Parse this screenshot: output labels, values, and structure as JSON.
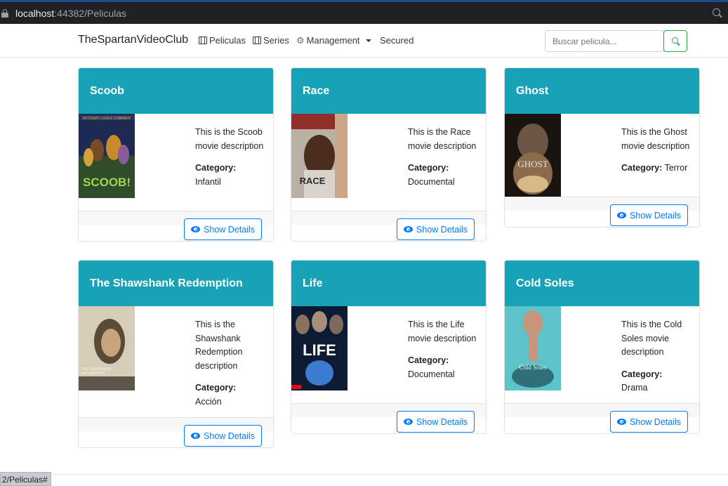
{
  "browser": {
    "url_host": "localhost",
    "url_rest": ":44382/Peliculas",
    "status_url": "2/Peliculas#"
  },
  "navbar": {
    "brand": "TheSpartanVideoClub",
    "items": [
      {
        "label": "Peliculas",
        "icon": "film-icon"
      },
      {
        "label": "Series",
        "icon": "film-icon"
      },
      {
        "label": "Management",
        "icon": "gear-icon"
      },
      {
        "label": "Secured"
      }
    ],
    "search_placeholder": "Buscar pelicula...",
    "search_button_color": "#28a745"
  },
  "movies": [
    {
      "title": "Scoob",
      "description": "This is the Scoob movie description",
      "category_label": "Category:",
      "category": "Infantil",
      "button": "Show Details"
    },
    {
      "title": "Race",
      "description": "This is the Race movie description",
      "category_label": "Category:",
      "category": "Documental",
      "button": "Show Details"
    },
    {
      "title": "Ghost",
      "description": "This is the Ghost movie description",
      "category_label": "Category:",
      "category": "Terror",
      "button": "Show Details"
    },
    {
      "title": "The Shawshank Redemption",
      "description": "This is the Shawshank Redemption description",
      "category_label": "Category:",
      "category": "Acción",
      "button": "Show Details"
    },
    {
      "title": "Life",
      "description": "This is the Life movie description",
      "category_label": "Category:",
      "category": "Documental",
      "button": "Show Details"
    },
    {
      "title": "Cold Soles",
      "description": "This is the Cold Soles movie description",
      "category_label": "Category:",
      "category": "Drama",
      "button": "Show Details"
    }
  ],
  "posters": {
    "scoob": "SCOOB!",
    "race": "RACE",
    "ghost": "GHOST",
    "shawshank": "THE SHAWSHANK REDEMPTION",
    "life": "LIFE",
    "coldsoles": "Cold Soles"
  },
  "colors": {
    "card_header": "#17a2b8",
    "primary": "#007bff"
  }
}
